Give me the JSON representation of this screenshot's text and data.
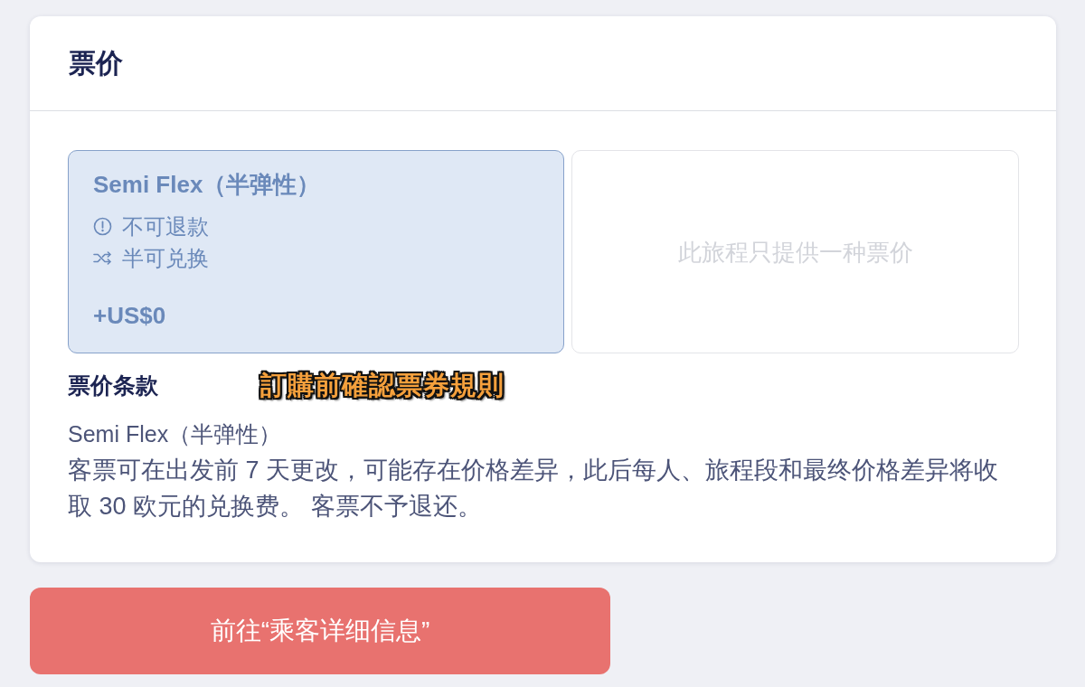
{
  "fare_panel": {
    "title": "票价",
    "fare_options": [
      {
        "name": "Semi Flex（半弹性）",
        "features": [
          {
            "kind": "refund",
            "text": "不可退款"
          },
          {
            "kind": "exchange",
            "text": "半可兑换"
          }
        ],
        "price": "+US$0",
        "selected": true
      }
    ],
    "single_fare_notice": "此旅程只提供一种票价",
    "terms": {
      "heading": "票价条款",
      "fare_name": "Semi Flex（半弹性）",
      "text": "客票可在出发前 7 天更改，可能存在价格差异，此后每人、旅程段和最终价格差异将收取 30 欧元的兑换费。 客票不予退还。"
    }
  },
  "annotation": "訂購前確認票券規則",
  "continue_button": "前往“乘客详细信息”"
}
